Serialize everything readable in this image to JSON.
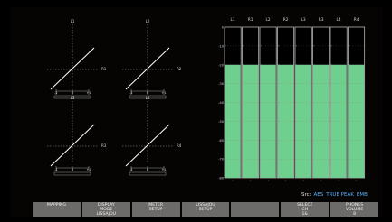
{
  "lissajous": [
    {
      "top": "L1",
      "right": "R1",
      "scale": [
        "-1",
        "0",
        "+1"
      ]
    },
    {
      "top": "L2",
      "right": "R2",
      "scale": [
        "-1",
        "0",
        "+1"
      ]
    },
    {
      "top": "L3",
      "right": "R3",
      "scale": [
        "-1",
        "0",
        "+1"
      ]
    },
    {
      "top": "L4",
      "right": "R4",
      "scale": [
        "-1",
        "0",
        "+1"
      ]
    }
  ],
  "meter": {
    "channels": [
      "L1",
      "R1",
      "L2",
      "R2",
      "L3",
      "R3",
      "L4",
      "R4"
    ],
    "scale": [
      "0",
      "-10",
      "-20",
      "-30",
      "-40",
      "-50",
      "-60",
      "-70",
      "-80"
    ],
    "level_db": -20,
    "fill_color": "#6fcf8e"
  },
  "status": {
    "src_label": "Src:",
    "src_value": "AES",
    "mode": "TRUE PEAK",
    "indicator": "EMB"
  },
  "softkeys": [
    {
      "lines": [
        "MAPPING"
      ]
    },
    {
      "lines": [
        "DISPLAY",
        "MODE",
        "LISSAJOU"
      ]
    },
    {
      "lines": [
        "METER",
        "SETUP"
      ]
    },
    {
      "lines": [
        "LISSAJOU",
        "SETUP"
      ]
    },
    {
      "lines": [
        ""
      ]
    },
    {
      "lines": [
        "SELECT",
        "CH",
        "1&"
      ]
    },
    {
      "lines": [
        "PHONES",
        "VOLUME",
        "8"
      ]
    }
  ]
}
